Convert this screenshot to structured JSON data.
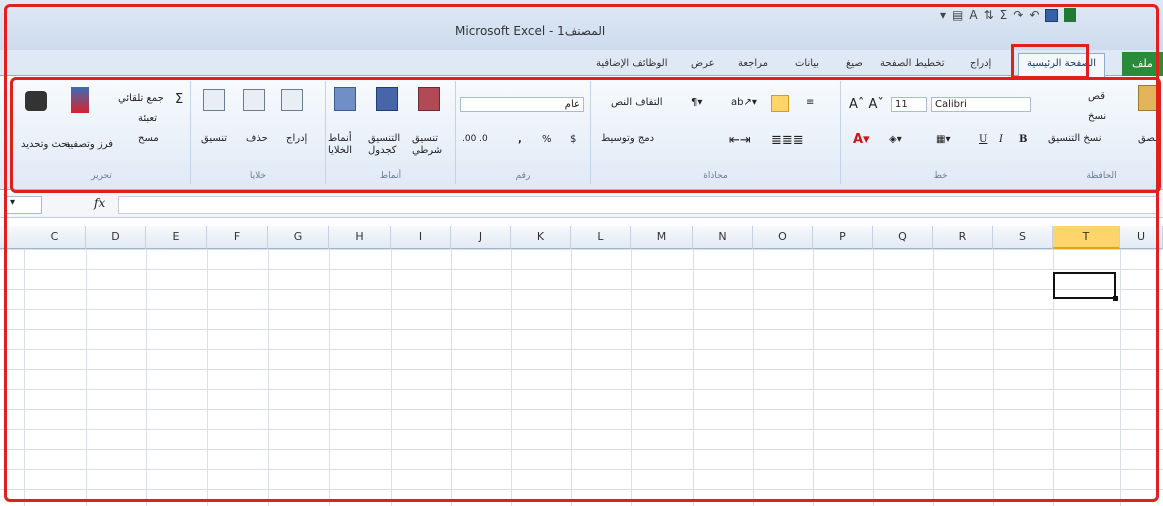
{
  "window": {
    "title": "Microsoft Excel - المصنف1"
  },
  "quick_access": {
    "icons": [
      "excel-logo-icon",
      "save-icon",
      "undo-icon",
      "redo-icon",
      "sum-icon"
    ]
  },
  "tabs": {
    "file": "ملف",
    "home": "الصفحة الرئيسية",
    "insert": "إدراج",
    "layout": "تخطيط الصفحة",
    "formulas": "صيغ",
    "data": "بيانات",
    "review": "مراجعة",
    "view": "عرض",
    "addins": "الوظائف الإضافية"
  },
  "ribbon": {
    "clipboard": {
      "label": "الحافظة",
      "paste": "لصق",
      "cut": "قص",
      "copy": "نسخ",
      "format_painter": "نسخ التنسيق"
    },
    "font": {
      "label": "خط",
      "name": "Calibri",
      "size": "11",
      "bold": "B",
      "italic": "I",
      "underline": "U"
    },
    "alignment": {
      "label": "محاذاة",
      "wrap": "التفاف النص",
      "merge": "دمج وتوسيط"
    },
    "number": {
      "label": "رقم",
      "format": "عام",
      "currency": "$",
      "percent": "%",
      "comma": ","
    },
    "styles": {
      "label": "أنماط",
      "conditional": "تنسيق شرطي",
      "table": "التنسيق كجدول",
      "cell": "أنماط الخلايا"
    },
    "cells": {
      "label": "خلايا",
      "insert": "إدراج",
      "delete": "حذف",
      "format": "تنسيق"
    },
    "editing": {
      "label": "تحرير",
      "autosum": "جمع تلقائي",
      "fill": "تعبئة",
      "clear": "مسح",
      "sort": "فرز وتصفية",
      "find": "بحث وتحديد"
    }
  },
  "formula_bar": {
    "fx": "fx"
  },
  "columns": [
    "U",
    "T",
    "S",
    "R",
    "Q",
    "P",
    "O",
    "N",
    "M",
    "L",
    "K",
    "J",
    "I",
    "H",
    "G",
    "F",
    "E",
    "D",
    "C"
  ],
  "selected_column": "T",
  "colors": {
    "highlight": "#e0201a",
    "file_tab": "#2a8c3a",
    "selection": "#111111"
  }
}
